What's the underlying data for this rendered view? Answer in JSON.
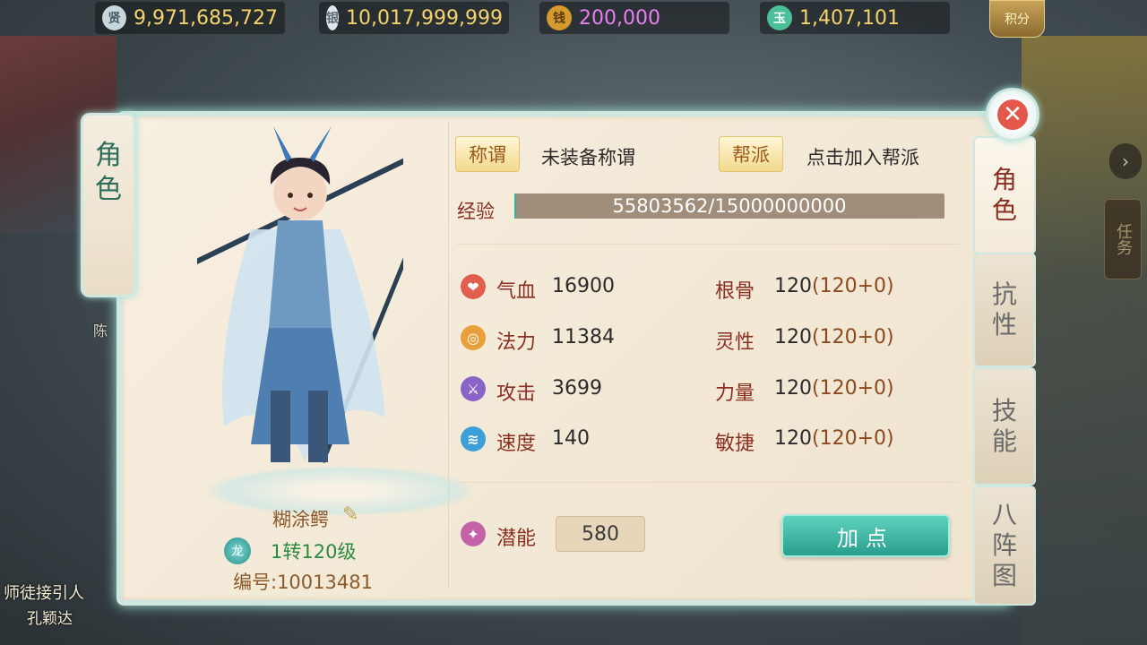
{
  "currencies": [
    {
      "icon": "coin-icon",
      "glyph": "贤",
      "value": "9,971,685,727"
    },
    {
      "icon": "silver-ingot-icon",
      "glyph": "银",
      "value": "10,017,999,999"
    },
    {
      "icon": "copper-coin-icon",
      "glyph": "钱",
      "value": "200,000"
    },
    {
      "icon": "jade-icon",
      "glyph": "玉",
      "value": "1,407,101"
    }
  ],
  "score_label": "积分",
  "left_tab": {
    "label": "角色"
  },
  "character": {
    "name": "糊涂鳄",
    "badge": "龙",
    "level": "1转120级",
    "id": "编号:10013481"
  },
  "title_tag": {
    "label": "称谓",
    "value": "未装备称谓"
  },
  "guild_tag": {
    "label": "帮派",
    "value": "点击加入帮派"
  },
  "exp": {
    "label": "经验",
    "text": "55803562/15000000000",
    "current": 55803562,
    "max": 15000000000
  },
  "stats_left": [
    {
      "icon": "blood-icon",
      "label": "气血",
      "value": "16900"
    },
    {
      "icon": "mana-icon",
      "label": "法力",
      "value": "11384"
    },
    {
      "icon": "attack-icon",
      "label": "攻击",
      "value": "3699"
    },
    {
      "icon": "speed-icon",
      "label": "速度",
      "value": "140"
    }
  ],
  "stats_right": [
    {
      "label": "根骨",
      "value": "120",
      "sub": "(120+0)"
    },
    {
      "label": "灵性",
      "value": "120",
      "sub": "(120+0)"
    },
    {
      "label": "力量",
      "value": "120",
      "sub": "(120+0)"
    },
    {
      "label": "敏捷",
      "value": "120",
      "sub": "(120+0)"
    }
  ],
  "potential": {
    "label": "潜能",
    "value": "580"
  },
  "add_points_label": "加点",
  "right_tabs": [
    "角色",
    "抗性",
    "技能",
    "八阵图"
  ],
  "bg": {
    "npc_line1": "师徒接引人",
    "npc_line2": "孔颖达",
    "side_label": "陈",
    "task_tab": "任务"
  }
}
